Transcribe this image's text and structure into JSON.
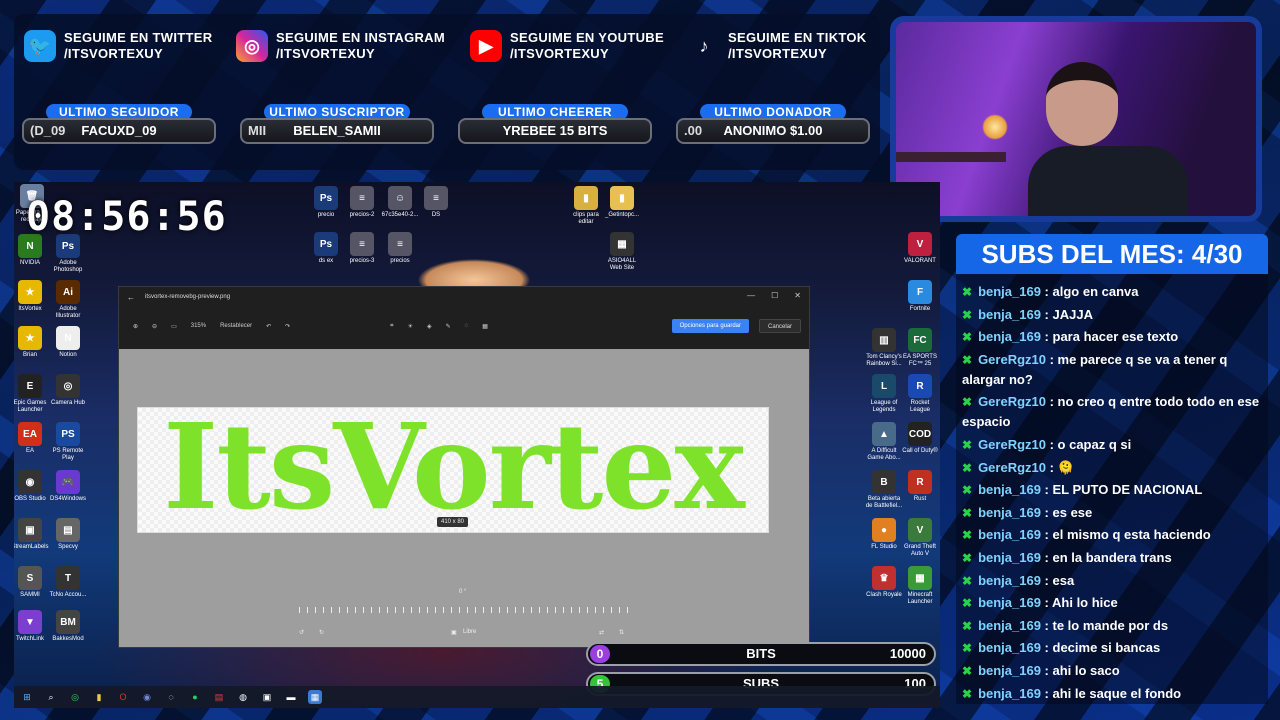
{
  "socials": [
    {
      "name": "twitter",
      "icon": "twitter-icon",
      "line1": "SEGUIME EN TWITTER",
      "line2": "/ITSVORTEXUY"
    },
    {
      "name": "instagram",
      "icon": "instagram-icon",
      "line1": "SEGUIME EN INSTAGRAM",
      "line2": "/ITSVORTEXUY"
    },
    {
      "name": "youtube",
      "icon": "youtube-icon",
      "line1": "SEGUIME EN YOUTUBE",
      "line2": "/ITSVORTEXUY"
    },
    {
      "name": "tiktok",
      "icon": "tiktok-icon",
      "line1": "SEGUIME EN TIKTOK",
      "line2": "/ITSVORTEXUY"
    }
  ],
  "stats": [
    {
      "label": "ULTIMO SEGUIDOR",
      "ghost": "(D_09",
      "value": "FACUXD_09"
    },
    {
      "label": "ULTIMO SUSCRIPTOR",
      "ghost": "MII",
      "value": "BELEN_SAMII"
    },
    {
      "label": "ULTIMO CHEERER",
      "ghost": "",
      "value": "YREBEE 15 BITS"
    },
    {
      "label": "ULTIMO DONADOR",
      "ghost": ".00",
      "value": "ANONIMO $1.00"
    }
  ],
  "clock": "08:56:56",
  "subs_title": "SUBS DEL MES: 4/30",
  "chat": [
    {
      "user": "benja_169",
      "msg": "algo en canva"
    },
    {
      "user": "benja_169",
      "msg": "JAJJA"
    },
    {
      "user": "benja_169",
      "msg": "para hacer ese texto"
    },
    {
      "user": "GereRgz10",
      "msg": "me parece q se va a tener q alargar no?"
    },
    {
      "user": "GereRgz10",
      "msg": "no creo q entre todo todo en ese espacio"
    },
    {
      "user": "GereRgz10",
      "msg": "o capaz q si"
    },
    {
      "user": "GereRgz10",
      "msg": "🫠"
    },
    {
      "user": "benja_169",
      "msg": "EL PUTO DE NACIONAL"
    },
    {
      "user": "benja_169",
      "msg": "es ese"
    },
    {
      "user": "benja_169",
      "msg": "el mismo q esta haciendo"
    },
    {
      "user": "benja_169",
      "msg": "en la bandera trans"
    },
    {
      "user": "benja_169",
      "msg": "esa"
    },
    {
      "user": "benja_169",
      "msg": "Ahi lo hice"
    },
    {
      "user": "benja_169",
      "msg": "te lo mande por ds"
    },
    {
      "user": "benja_169",
      "msg": "decime si bancas"
    },
    {
      "user": "benja_169",
      "msg": "ahi lo saco"
    },
    {
      "user": "benja_169",
      "msg": "ahi le saque el fondo"
    }
  ],
  "editor": {
    "filename": "itsvortex-removebg-preview.png",
    "zoom": "315%",
    "reset": "Restablecer",
    "save_options": "Opciones para guardar",
    "cancel": "Cancelar",
    "image_text": "ItsVortex",
    "dims": "410 x 80",
    "angle": "0 °",
    "aspect": "Libre"
  },
  "goals": [
    {
      "num": "0",
      "label": "BITS",
      "target": "10000",
      "color": "#9b3fe0"
    },
    {
      "num": "5",
      "label": "SUBS",
      "target": "100",
      "color": "#38c238"
    }
  ],
  "desktop_icons_left": [
    {
      "label": "Papelera de reciclaje",
      "color": "#6a7fa0",
      "glyph": "🗑"
    },
    {
      "label": "NVIDIA",
      "color": "#2a7a20",
      "glyph": "N"
    },
    {
      "label": "ItsVortex",
      "color": "#e6b800",
      "glyph": "★"
    },
    {
      "label": "Brian",
      "color": "#e6b800",
      "glyph": "★"
    },
    {
      "label": "Epic Games Launcher",
      "color": "#222",
      "glyph": "E"
    },
    {
      "label": "EA",
      "color": "#d0301a",
      "glyph": "EA"
    },
    {
      "label": "OBS Studio",
      "color": "#333",
      "glyph": "◉"
    },
    {
      "label": "StreamLabels",
      "color": "#444",
      "glyph": "▣"
    },
    {
      "label": "SAMMI",
      "color": "#555",
      "glyph": "S"
    },
    {
      "label": "TwitchLink",
      "color": "#7a3fd0",
      "glyph": "▼"
    }
  ],
  "desktop_icons_left2": [
    {
      "label": "Adobe Photoshop",
      "color": "#1a3a7a",
      "glyph": "Ps"
    },
    {
      "label": "Adobe Illustrator",
      "color": "#5a2a00",
      "glyph": "Ai"
    },
    {
      "label": "Notion",
      "color": "#eee",
      "glyph": "N"
    },
    {
      "label": "Camera Hub",
      "color": "#333",
      "glyph": "◎"
    },
    {
      "label": "PS Remote Play",
      "color": "#1a4aa0",
      "glyph": "PS"
    },
    {
      "label": "DS4Windows",
      "color": "#6a3ad0",
      "glyph": "🎮"
    },
    {
      "label": "Specvy",
      "color": "#666",
      "glyph": "▤"
    },
    {
      "label": "TcNo Accou...",
      "color": "#333",
      "glyph": "T"
    },
    {
      "label": "BakkesMod",
      "color": "#444",
      "glyph": "BM"
    }
  ],
  "desktop_icons_top": [
    {
      "label": "precio",
      "color": "#1a3a7a",
      "glyph": "Ps"
    },
    {
      "label": "precios-2",
      "color": "#556",
      "glyph": "≡"
    },
    {
      "label": "67c35e40-2...",
      "color": "#556",
      "glyph": "☺"
    },
    {
      "label": "DS",
      "color": "#556",
      "glyph": "≡"
    },
    {
      "label": "ds ex",
      "color": "#1a3a7a",
      "glyph": "Ps"
    },
    {
      "label": "precios-3",
      "color": "#556",
      "glyph": "≡"
    },
    {
      "label": "precios",
      "color": "#556",
      "glyph": "≡"
    },
    {
      "label": "clips para editar",
      "color": "#d8b040",
      "glyph": "▮"
    },
    {
      "label": "_Getintopc...",
      "color": "#e8c050",
      "glyph": "▮"
    },
    {
      "label": "ASIO4ALL Web Site",
      "color": "#333",
      "glyph": "▦"
    }
  ],
  "desktop_icons_right": [
    {
      "label": "VALORANT",
      "color": "#c02040",
      "glyph": "V"
    },
    {
      "label": "Fortnite",
      "color": "#2a8ae0",
      "glyph": "F"
    },
    {
      "label": "Tom Clancy's Rainbow Si...",
      "color": "#333",
      "glyph": "▥"
    },
    {
      "label": "League of Legends",
      "color": "#1a4a6a",
      "glyph": "L"
    },
    {
      "label": "A Difficult Game Abo...",
      "color": "#4a6a8a",
      "glyph": "▲"
    },
    {
      "label": "Beta abierta de Battlefiel...",
      "color": "#333",
      "glyph": "B"
    },
    {
      "label": "FL Studio",
      "color": "#e08020",
      "glyph": "●"
    },
    {
      "label": "Clash Royale",
      "color": "#c03030",
      "glyph": "♛"
    },
    {
      "label": "EA SPORTS FC™ 25",
      "color": "#1a6a3a",
      "glyph": "FC"
    },
    {
      "label": "Rocket League",
      "color": "#1a4ab0",
      "glyph": "R"
    },
    {
      "label": "Call of Duty®",
      "color": "#222",
      "glyph": "COD"
    },
    {
      "label": "Rust",
      "color": "#c03020",
      "glyph": "R"
    },
    {
      "label": "Grand Theft Auto V",
      "color": "#3a7a3a",
      "glyph": "V"
    },
    {
      "label": "Minecraft Launcher",
      "color": "#3a9a3a",
      "glyph": "▦"
    }
  ]
}
